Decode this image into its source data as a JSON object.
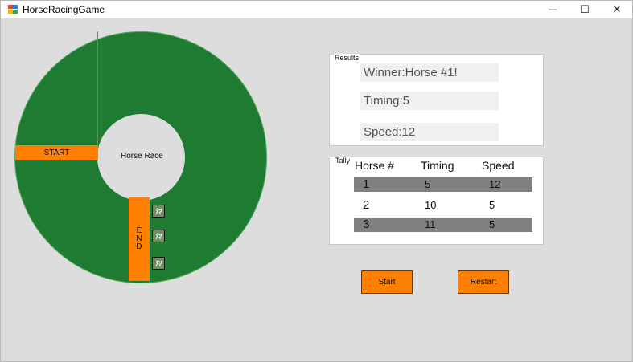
{
  "window": {
    "title": "HorseRacingGame",
    "minimize_glyph": "—",
    "maximize_glyph": "☐",
    "close_glyph": "✕"
  },
  "track": {
    "start_label": "START",
    "center_label": "Horse Race",
    "end_label": "E\nN\nD",
    "colors": {
      "grass": "#1e7b31",
      "banner": "#ff7f00",
      "background": "#dddddd"
    },
    "horse_icon": "horse-icon"
  },
  "results": {
    "caption": "Results",
    "winner": "Winner:Horse #1!",
    "timing": "Timing:5",
    "speed": "Speed:12"
  },
  "tally": {
    "caption": "Tally",
    "headers": [
      "Horse #",
      "Timing",
      "Speed"
    ],
    "rows": [
      {
        "horse": "1",
        "timing": "5",
        "speed": "12"
      },
      {
        "horse": "2",
        "timing": "10",
        "speed": "5"
      },
      {
        "horse": "3",
        "timing": "11",
        "speed": "5"
      }
    ]
  },
  "actions": {
    "start_label": "Start",
    "restart_label": "Restart"
  }
}
